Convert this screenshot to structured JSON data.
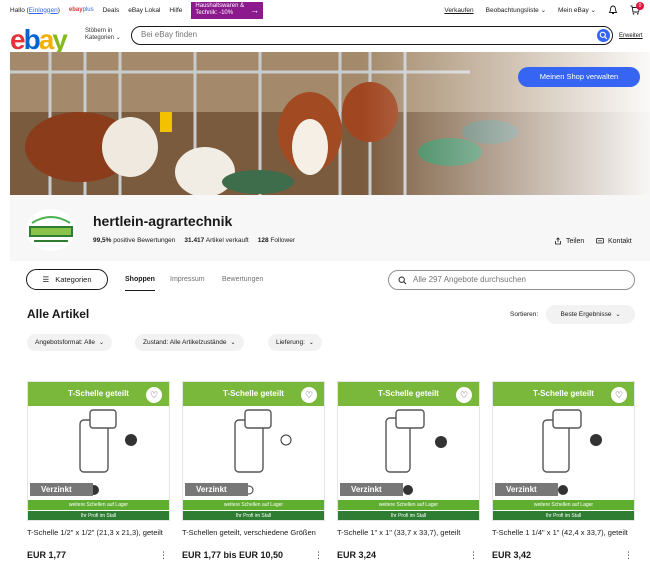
{
  "topnav": {
    "greeting": "Hallo (",
    "signin": "Einloggen",
    "greeting_end": ")",
    "links": [
      "Deals",
      "eBay Lokal",
      "Hilfe"
    ],
    "promo_line1": "Haushaltswaren &",
    "promo_line2": "Technik: -10%",
    "right": [
      "Verkaufen",
      "Beobachtungsliste",
      "Mein eBay"
    ],
    "cart_count": "0"
  },
  "header": {
    "cat_line1": "Stöbern in",
    "cat_line2": "Kategorien",
    "search_placeholder": "Bei eBay finden",
    "extended": "Erweitert"
  },
  "banner": {
    "manage_button": "Meinen Shop verwalten"
  },
  "store": {
    "name": "hertlein-agrartechnik",
    "rating": "99,5%",
    "rating_label": "positive Bewertungen",
    "sold": "31.417",
    "sold_label": "Artikel verkauft",
    "followers": "128",
    "followers_label": "Follower",
    "share": "Teilen",
    "contact": "Kontakt"
  },
  "tabs": {
    "categories": "Kategorien",
    "items": [
      "Shoppen",
      "Impressum",
      "Bewertungen"
    ],
    "search_placeholder": "Alle 297 Angebote durchsuchen"
  },
  "listing": {
    "title": "Alle Artikel",
    "sort_label": "Sortieren:",
    "sort_value": "Beste Ergebnisse",
    "filters": [
      "Angebotsformat: Alle",
      "Zustand: Alle Artikelzustände",
      "Lieferung:"
    ]
  },
  "products": [
    {
      "ribbon": "T-Schelle geteilt",
      "badge": "Verzinkt",
      "stock": "weitere Schellen auf Lager",
      "profi": "Ihr Profi im Stall",
      "title": "T-Schelle 1/2\" x 1/2\" (21,3 x 21,3), geteilt",
      "price": "EUR 1,77"
    },
    {
      "ribbon": "T-Schelle geteilt",
      "badge": "Verzinkt",
      "stock": "weitere Schellen auf Lager",
      "profi": "Ihr Profi im Stall",
      "title": "T-Schellen geteilt, verschiedene Größen",
      "price": "EUR 1,77 bis EUR 10,50"
    },
    {
      "ribbon": "T-Schelle geteilt",
      "badge": "Verzinkt",
      "stock": "weitere Schellen auf Lager",
      "profi": "Ihr Profi im Stall",
      "title": "T-Schelle 1\" x 1\" (33,7 x 33,7), geteilt",
      "price": "EUR 3,24"
    },
    {
      "ribbon": "T-Schelle geteilt",
      "badge": "Verzinkt",
      "stock": "weitere Schellen auf Lager",
      "profi": "Ihr Profi im Stall",
      "title": "T-Schelle 1 1/4\" x 1\" (42,4 x 33,7), geteilt",
      "price": "EUR 3,42"
    }
  ],
  "colors": {
    "accent": "#3665f3",
    "promo": "#8c1a8c",
    "ribbon": "#79b83a"
  }
}
